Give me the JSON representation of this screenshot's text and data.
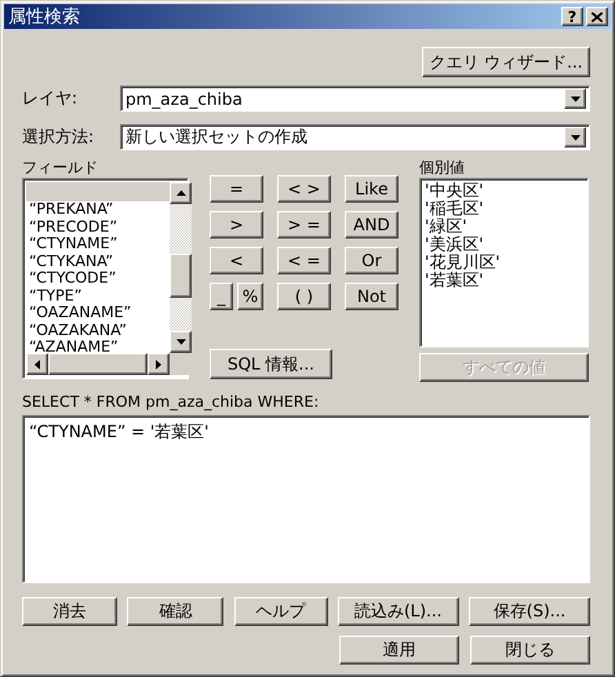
{
  "window": {
    "title": "属性検索",
    "help_button": "?"
  },
  "query_wizard_button": "クエリ ウィザード...",
  "layer": {
    "label": "レイヤ:",
    "value": "pm_aza_chiba"
  },
  "method": {
    "label": "選択方法:",
    "value": "新しい選択セットの作成"
  },
  "fields": {
    "label": "フィールド",
    "items": [
      "“PREKANA”",
      "“PRECODE”",
      "“CTYNAME”",
      "“CTYKANA”",
      "“CTYCODE”",
      "“TYPE”",
      "“OAZANAME”",
      "“OAZAKANA”",
      "“AZANAME”"
    ]
  },
  "operators": [
    "=",
    "< >",
    "Like",
    ">",
    "> =",
    "AND",
    "<",
    "< =",
    "Or",
    "_",
    "%",
    "( )",
    "Not"
  ],
  "sql_info_button": "SQL 情報...",
  "unique_values": {
    "label": "個別値",
    "items": [
      "'中央区'",
      "'稲毛区'",
      "'緑区'",
      "'美浜区'",
      "'花見川区'",
      "'若葉区'"
    ]
  },
  "all_values_button": {
    "label": "すべての値",
    "disabled": true
  },
  "sql": {
    "label": "SELECT * FROM pm_aza_chiba WHERE:",
    "value": "“CTYNAME” = '若葉区'"
  },
  "buttons": [
    "消去",
    "確認",
    "ヘルプ",
    "読込み(L)...",
    "保存(S)..."
  ],
  "dialog_buttons": [
    "適用",
    "閉じる"
  ]
}
